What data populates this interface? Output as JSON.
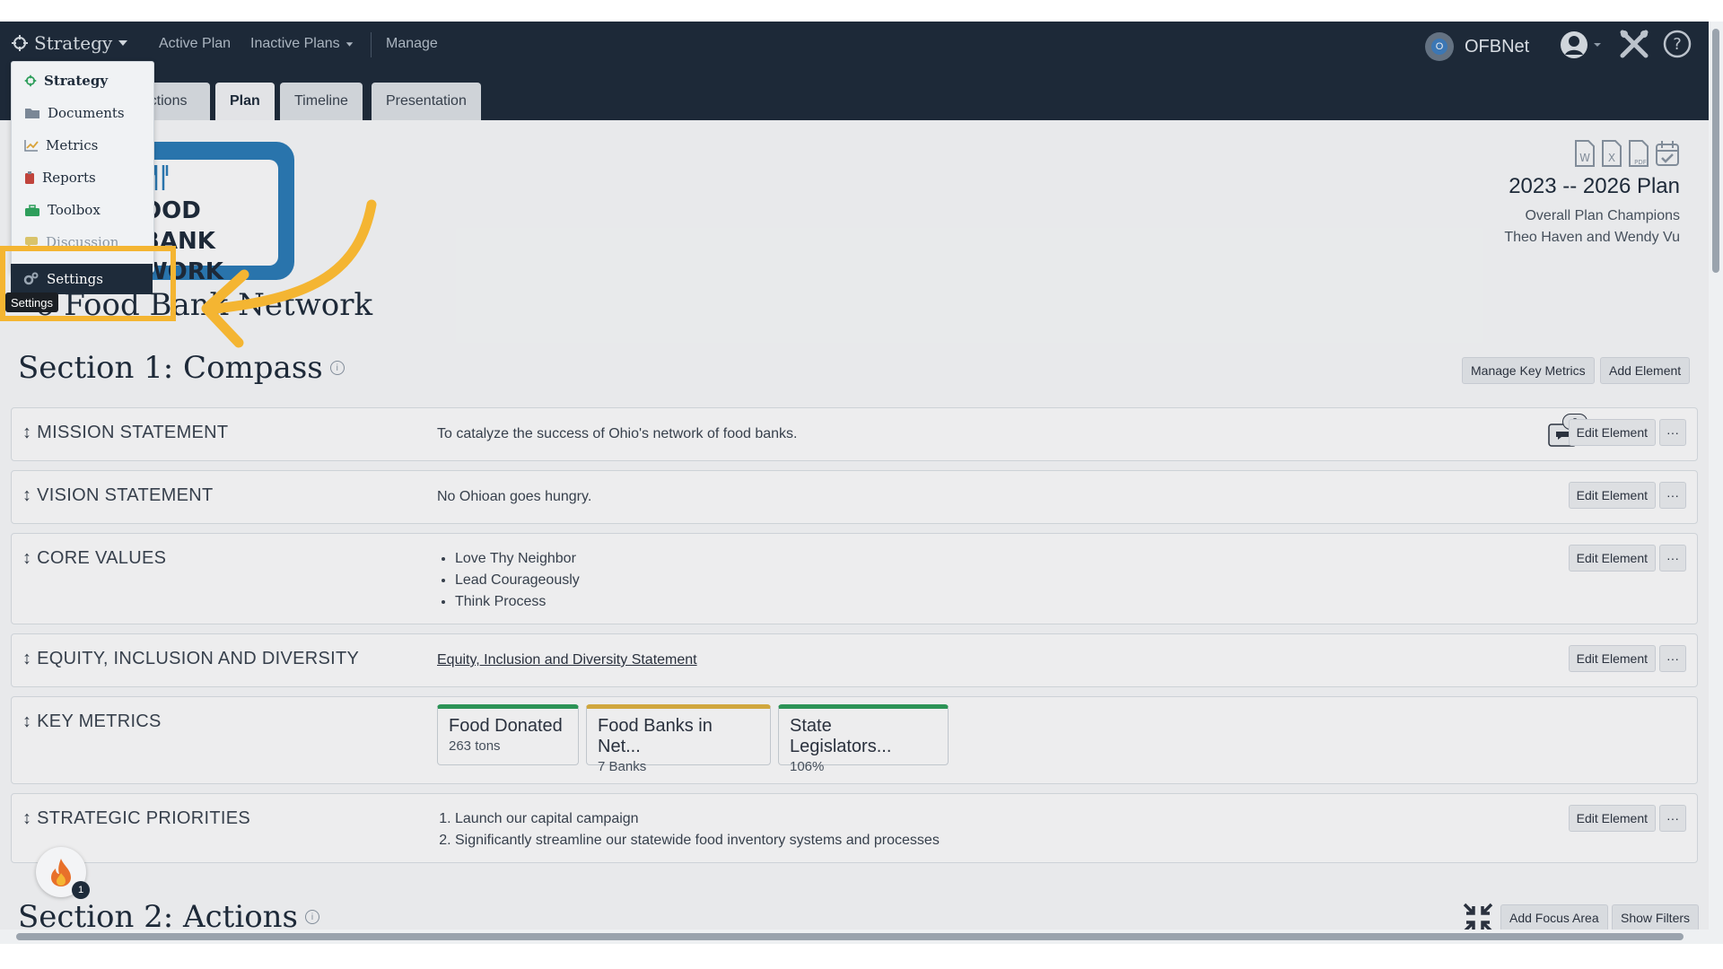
{
  "nav": {
    "brand": "Strategy",
    "links": [
      "Active Plan",
      "Inactive Plans",
      "Manage"
    ],
    "org_name": "OFBNet"
  },
  "tabs": [
    "Actions",
    "Plan",
    "Timeline",
    "Presentation"
  ],
  "dropdown": {
    "items": [
      "Strategy",
      "Documents",
      "Metrics",
      "Reports",
      "Toolbox",
      "Discussion"
    ],
    "selected": "Settings",
    "tooltip": "Settings"
  },
  "plan": {
    "logo_lines": [
      "OOD BANK",
      "WORK"
    ],
    "name_visible": "o Food Bank Network",
    "range": "2023 -- 2026 Plan",
    "champions_label": "Overall Plan Champions",
    "champions": "Theo Haven and Wendy Vu"
  },
  "section1": {
    "title": "Section 1: Compass",
    "buttons": [
      "Manage Key Metrics",
      "Add Element"
    ]
  },
  "elements": {
    "mission": {
      "label": "MISSION STATEMENT",
      "text": "To catalyze the success of Ohio's network of food banks.",
      "comments": "3"
    },
    "vision": {
      "label": "VISION STATEMENT",
      "text": "No Ohioan goes hungry."
    },
    "core": {
      "label": "CORE VALUES",
      "items": [
        "Love Thy Neighbor",
        "Lead Courageously",
        "Think Process"
      ]
    },
    "equity": {
      "label": "EQUITY, INCLUSION AND DIVERSITY",
      "link": "Equity, Inclusion and Diversity Statement"
    },
    "metrics": {
      "label": "KEY METRICS",
      "cards": [
        {
          "name": "Food Donated",
          "value": "263 tons",
          "color": "#2e9e5b"
        },
        {
          "name": "Food Banks in Net...",
          "value": "7 Banks",
          "color": "#e0b441"
        },
        {
          "name": "State Legislators...",
          "value": "106%",
          "color": "#2e9e5b"
        }
      ]
    },
    "priorities": {
      "label": "STRATEGIC PRIORITIES",
      "items": [
        "Launch our capital campaign",
        "Significantly streamline our statewide food inventory systems and processes"
      ]
    }
  },
  "edit_label": "Edit Element",
  "more_label": "···",
  "section2": {
    "title": "Section 2: Actions",
    "buttons": [
      "Add Focus Area",
      "Show Filters"
    ]
  },
  "fire_count": "1",
  "colors": {
    "nav_bg": "#1e2b3a",
    "highlight": "#f4b532"
  }
}
